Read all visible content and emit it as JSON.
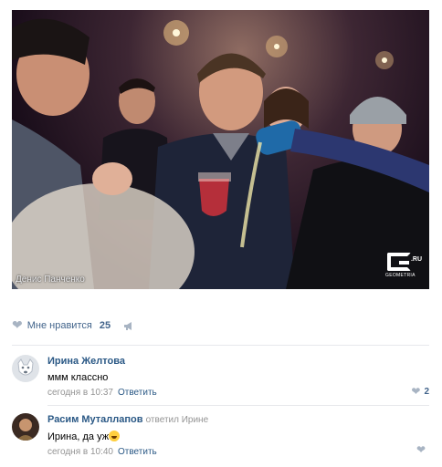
{
  "photo": {
    "credit": "Денис Панченко",
    "watermark": {
      "domain": ".RU",
      "brand": "GEOMETRIA"
    }
  },
  "likes": {
    "label": "Мне нравится",
    "count": "25"
  },
  "comments": [
    {
      "author": "Ирина Желтова",
      "reply_to": "",
      "text": "ммм классно",
      "date": "сегодня в 10:37",
      "reply_label": "Ответить",
      "likes": "2"
    },
    {
      "author": "Расим Муталлапов",
      "reply_to": "ответил Ирине",
      "text": "Ирина, да уж",
      "date": "сегодня в 10:40",
      "reply_label": "Ответить",
      "likes": ""
    }
  ],
  "colors": {
    "link": "#2a5885",
    "muted": "#939393",
    "icon": "#a8b4c3"
  }
}
